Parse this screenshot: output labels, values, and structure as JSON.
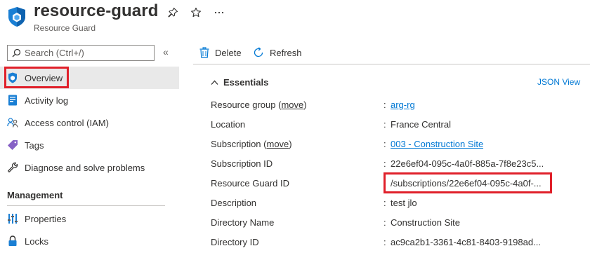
{
  "header": {
    "title": "resource-guard",
    "subtitle": "Resource Guard"
  },
  "search": {
    "placeholder": "Search (Ctrl+/)"
  },
  "nav": {
    "items": [
      {
        "label": "Overview",
        "icon": "shield-icon"
      },
      {
        "label": "Activity log",
        "icon": "activity-log-icon"
      },
      {
        "label": "Access control (IAM)",
        "icon": "people-icon"
      },
      {
        "label": "Tags",
        "icon": "tag-icon"
      },
      {
        "label": "Diagnose and solve problems",
        "icon": "wrench-icon"
      }
    ],
    "section_management": "Management",
    "management_items": [
      {
        "label": "Properties",
        "icon": "properties-icon"
      },
      {
        "label": "Locks",
        "icon": "lock-icon"
      }
    ]
  },
  "toolbar": {
    "delete_label": "Delete",
    "refresh_label": "Refresh"
  },
  "essentials": {
    "title": "Essentials",
    "json_view": "JSON View",
    "move_label": "move",
    "rows": [
      {
        "label": "Resource group",
        "value": "arg-rg"
      },
      {
        "label": "Location",
        "value": "France Central"
      },
      {
        "label": "Subscription",
        "value": "003 - Construction Site"
      },
      {
        "label": "Subscription ID",
        "value": "22e6ef04-095c-4a0f-885a-7f8e23c5..."
      },
      {
        "label": "Resource Guard ID",
        "value": "/subscriptions/22e6ef04-095c-4a0f-..."
      },
      {
        "label": "Description",
        "value": "test jlo"
      },
      {
        "label": "Directory Name",
        "value": "Construction Site"
      },
      {
        "label": "Directory ID",
        "value": "ac9ca2b1-3361-4c81-8403-9198ad..."
      }
    ]
  },
  "colors": {
    "accent": "#0078d4",
    "highlight": "#e0202a",
    "nav_active_bg": "#e9e9e9"
  }
}
